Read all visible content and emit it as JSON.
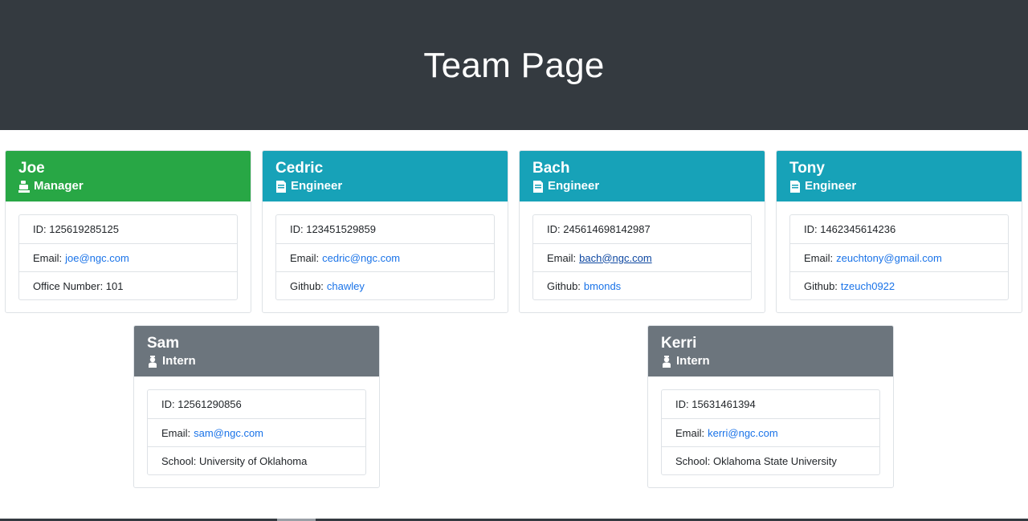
{
  "header": {
    "title": "Team Page"
  },
  "cards": [
    {
      "name": "Joe",
      "role": "Manager",
      "role_icon": "mug-icon",
      "id": "ID: 125619285125",
      "email_label": "Email:",
      "email": "joe@ngc.com",
      "extra": "Office Number: 101"
    },
    {
      "name": "Cedric",
      "role": "Engineer",
      "role_icon": "glasses-icon",
      "id": "ID: 123451529859",
      "email_label": "Email:",
      "email": "cedric@ngc.com",
      "extra_label": "Github:",
      "extra_link": "chawley"
    },
    {
      "name": "Bach",
      "role": "Engineer",
      "role_icon": "glasses-icon",
      "id": "ID: 245614698142987",
      "email_label": "Email:",
      "email": "bach@ngc.com",
      "extra_label": "Github:",
      "extra_link": "bmonds"
    },
    {
      "name": "Tony",
      "role": "Engineer",
      "role_icon": "glasses-icon",
      "id": "ID: 1462345614236",
      "email_label": "Email:",
      "email": "zeuchtony@gmail.com",
      "extra_label": "Github:",
      "extra_link": "tzeuch0922"
    },
    {
      "name": "Sam",
      "role": "Intern",
      "role_icon": "graduate-icon",
      "id": "ID: 12561290856",
      "email_label": "Email:",
      "email": "sam@ngc.com",
      "extra": "School: University of Oklahoma"
    },
    {
      "name": "Kerri",
      "role": "Intern",
      "role_icon": "graduate-icon",
      "id": "ID: 15631461394",
      "email_label": "Email:",
      "email": "kerri@ngc.com",
      "extra": "School: Oklahoma State University"
    }
  ],
  "colors": {
    "header_bg": "#343a40",
    "manager": "#28a745",
    "engineer": "#17a2b8",
    "intern": "#6c757d",
    "link": "#1a73e8"
  }
}
